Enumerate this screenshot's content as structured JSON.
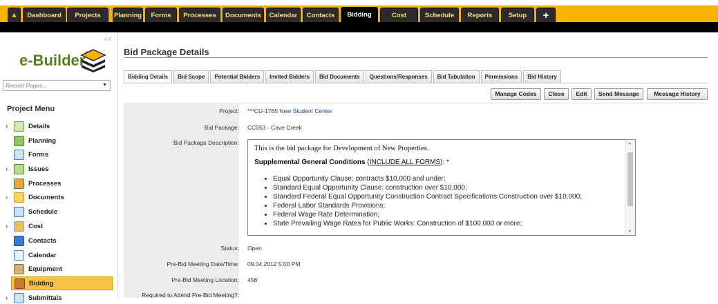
{
  "nav": {
    "tabs": [
      {
        "label": "Dashboard"
      },
      {
        "label": "Projects"
      },
      {
        "label": "Planning"
      },
      {
        "label": "Forms"
      },
      {
        "label": "Processes"
      },
      {
        "label": "Documents"
      },
      {
        "label": "Calendar"
      },
      {
        "label": "Contacts"
      },
      {
        "label": "Bidding"
      },
      {
        "label": "Cost"
      },
      {
        "label": "Schedule"
      },
      {
        "label": "Reports"
      },
      {
        "label": "Setup"
      }
    ],
    "home_icon": "home-icon",
    "add_icon": "plus-icon",
    "colors": {
      "bar": "#f4b400",
      "tab": "#2b2b2b",
      "tab_text": "#ffdc7a"
    }
  },
  "sidebar": {
    "collapse": "<<",
    "logo_text": "e-Builder",
    "logo_reg": "®",
    "recent_placeholder": "Recent Pages...",
    "menu_title": "Project Menu",
    "items": [
      {
        "label": "Details",
        "icon": "details-icon"
      },
      {
        "label": "Planning",
        "icon": "planning-icon"
      },
      {
        "label": "Forms",
        "icon": "forms-icon"
      },
      {
        "label": "Issues",
        "icon": "issues-icon"
      },
      {
        "label": "Processes",
        "icon": "processes-icon"
      },
      {
        "label": "Documents",
        "icon": "folder-icon"
      },
      {
        "label": "Schedule",
        "icon": "schedule-icon"
      },
      {
        "label": "Cost",
        "icon": "cost-icon"
      },
      {
        "label": "Contacts",
        "icon": "contacts-icon"
      },
      {
        "label": "Calendar",
        "icon": "calendar-icon"
      },
      {
        "label": "Equipment",
        "icon": "equipment-icon"
      },
      {
        "label": "Bidding",
        "icon": "bidding-icon"
      },
      {
        "label": "Submittals",
        "icon": "submittals-icon"
      }
    ]
  },
  "main": {
    "title": "Bid Package Details",
    "tabs": [
      {
        "label": "Bidding Details"
      },
      {
        "label": "Bid Scope"
      },
      {
        "label": "Potential Bidders"
      },
      {
        "label": "Invited Bidders"
      },
      {
        "label": "Bid Documents"
      },
      {
        "label": "Questions/Responses"
      },
      {
        "label": "Bid Tabulation"
      },
      {
        "label": "Permissions"
      },
      {
        "label": "Bid History"
      }
    ],
    "buttons": {
      "manage_codes": "Manage Codes",
      "close": "Close",
      "edit": "Edit",
      "send_message": "Send Message",
      "message_history": "Message History"
    },
    "fields": {
      "project_label": "Project:",
      "project_value": "***CU-1765 New Student Center",
      "bid_package_label": "Bid Package:",
      "bid_package_value": "CC053 - Cave Creek",
      "description_label": "Bid Package Description:",
      "status_label": "Status:",
      "status_value": "Open",
      "meeting_dt_label": "Pre-Bid Meeting Date/Time:",
      "meeting_dt_value": "09.04.2012 5:00 PM",
      "meeting_loc_label": "Pre-Bid Meeting Location:",
      "meeting_loc_value": "456",
      "required_label": "Required to Attend Pre-Bid Meeting?:"
    },
    "description": {
      "intro": "This is the bid package for Development of New Properties.",
      "supp_bold": "Supplemental General Conditions",
      "supp_link": "INCLUDE ALL FORMS",
      "supp_tail": ": *",
      "items": [
        "Equal Opportunity Clause: contracts $10,000 and under;",
        "Standard Equal Opportunity Clause: construction over $10,000;",
        "Standard Federal Equal Opportunity Construction Contract Specifications:Construction over $10,000;",
        "Federal Labor Standards Provisions;",
        "Federal Wage Rate Determination;",
        "State Prevailing Wage Rates for Public Works: Construction of $100,000 or more;"
      ]
    }
  }
}
